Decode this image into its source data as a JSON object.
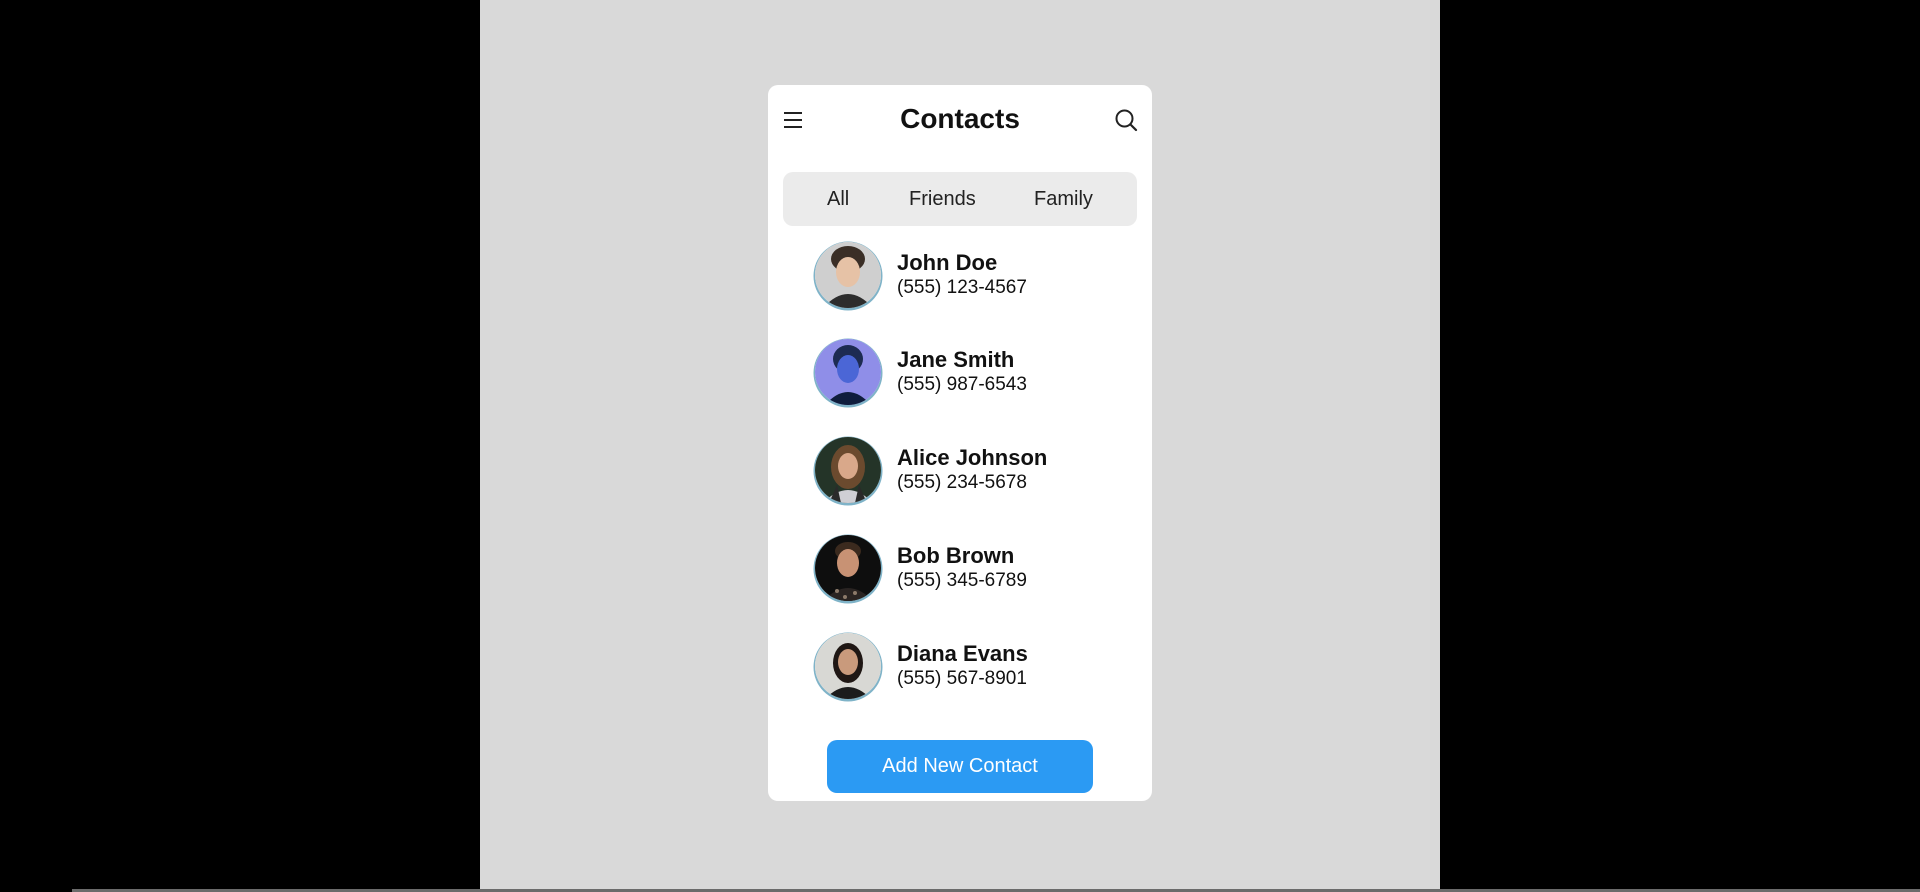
{
  "header": {
    "title": "Contacts",
    "menu_icon": "hamburger-menu-icon",
    "search_icon": "search-icon"
  },
  "tabs": [
    {
      "label": "All"
    },
    {
      "label": "Friends"
    },
    {
      "label": "Family"
    }
  ],
  "contacts": [
    {
      "name": "John Doe",
      "phone": "(555) 123-4567"
    },
    {
      "name": "Jane Smith",
      "phone": "(555) 987-6543"
    },
    {
      "name": "Alice Johnson",
      "phone": "(555) 234-5678"
    },
    {
      "name": "Bob Brown",
      "phone": "(555) 345-6789"
    },
    {
      "name": "Diana Evans",
      "phone": "(555) 567-8901"
    }
  ],
  "actions": {
    "add_label": "Add New Contact"
  },
  "colors": {
    "accent": "#2b9af3",
    "page_background": "#d9d9d9",
    "card_background": "#ffffff",
    "tab_background": "#ebebeb"
  }
}
